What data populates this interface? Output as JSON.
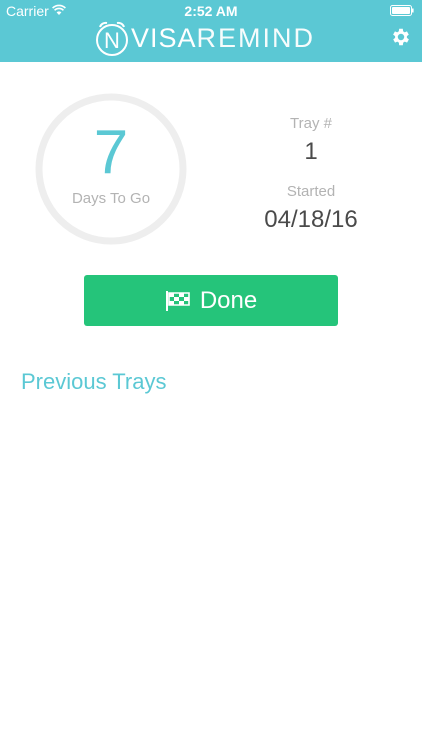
{
  "status_bar": {
    "carrier": "Carrier",
    "time": "2:52 AM",
    "wifi_icon": "wifi-icon",
    "battery_icon": "battery-icon"
  },
  "header": {
    "logo_bold": "VISA",
    "logo_thin": "REMIND",
    "logo_badge_letter": "N",
    "settings_icon": "gear-icon",
    "background_color": "#5bc8d4"
  },
  "countdown": {
    "days": "7",
    "caption": "Days To Go",
    "accent_color": "#5bc8d4"
  },
  "tray": {
    "label": "Tray #",
    "value": "1"
  },
  "started": {
    "label": "Started",
    "value": "04/18/16"
  },
  "done_button": {
    "label": "Done",
    "icon": "checkered-flag-icon",
    "color": "#25c47a"
  },
  "previous": {
    "title": "Previous Trays"
  }
}
